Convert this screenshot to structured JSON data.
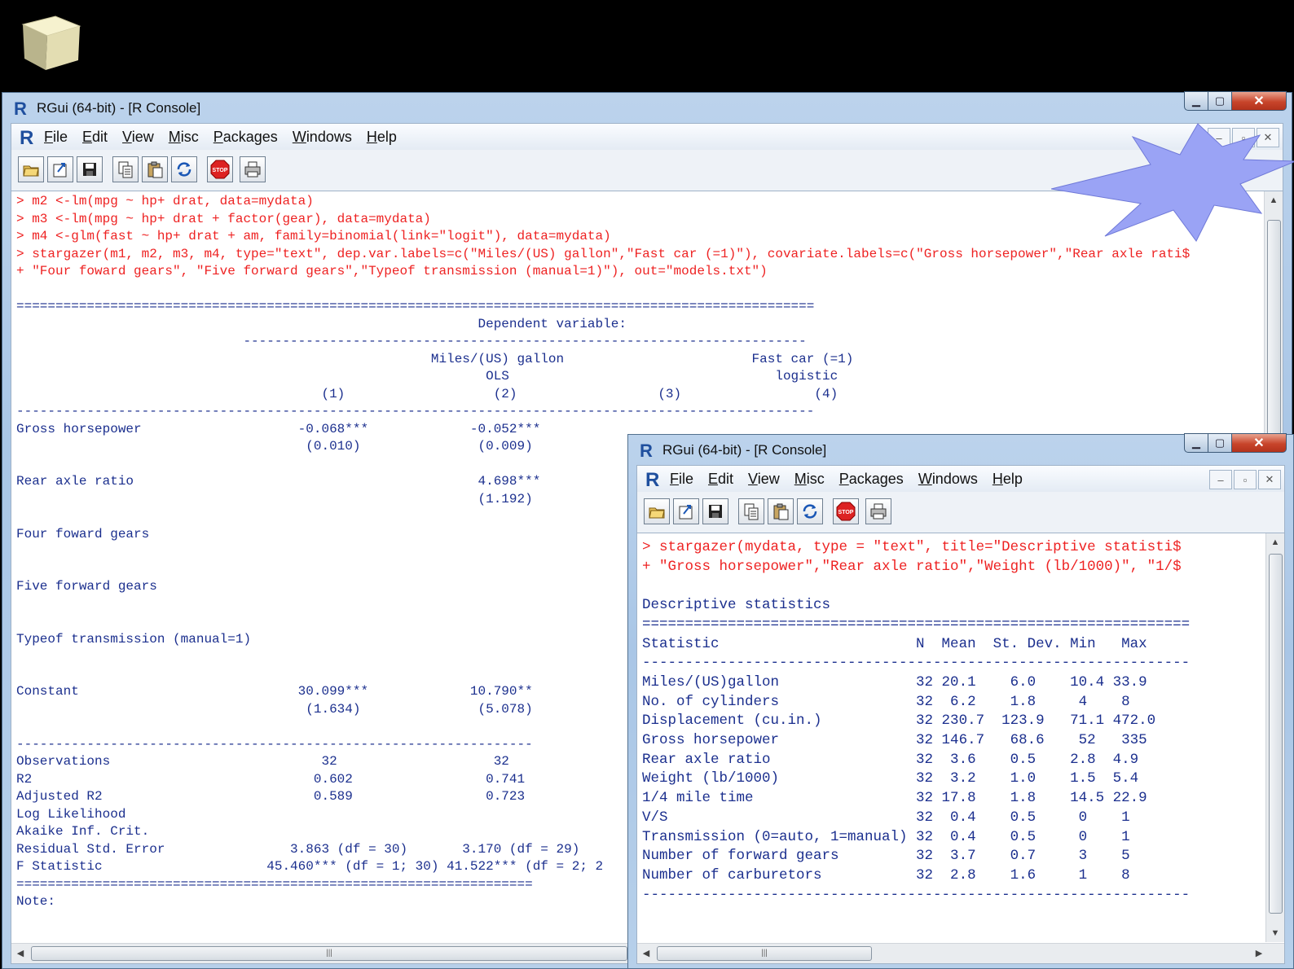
{
  "main_window": {
    "title": "RGui (64-bit) - [R Console]",
    "menus": [
      "File",
      "Edit",
      "View",
      "Misc",
      "Packages",
      "Windows",
      "Help"
    ],
    "console_lines": [
      {
        "t": "cmd",
        "s": "> m2 <-lm(mpg ~ hp+ drat, data=mydata)"
      },
      {
        "t": "cmd",
        "s": "> m3 <-lm(mpg ~ hp+ drat + factor(gear), data=mydata)"
      },
      {
        "t": "cmd",
        "s": "> m4 <-glm(fast ~ hp+ drat + am, family=binomial(link=\"logit\"), data=mydata)"
      },
      {
        "t": "cmd",
        "s": "> stargazer(m1, m2, m3, m4, type=\"text\", dep.var.labels=c(\"Miles/(US) gallon\",\"Fast car (=1)\"), covariate.labels=c(\"Gross horsepower\",\"Rear axle rati$"
      },
      {
        "t": "cmd",
        "s": "+ \"Four foward gears\", \"Five forward gears\",\"Typeof transmission (manual=1)\"), out=\"models.txt\")"
      },
      {
        "t": "out",
        "s": ""
      },
      {
        "t": "out",
        "s": "======================================================================================================"
      },
      {
        "t": "out",
        "s": "                                                           Dependent variable:"
      },
      {
        "t": "out",
        "s": "                             ------------------------------------------------------------------------"
      },
      {
        "t": "out",
        "s": "                                                     Miles/(US) gallon                        Fast car (=1)"
      },
      {
        "t": "out",
        "s": "                                                            OLS                                  logistic"
      },
      {
        "t": "out",
        "s": "                                       (1)                   (2)                  (3)                 (4)"
      },
      {
        "t": "out",
        "s": "------------------------------------------------------------------------------------------------------"
      },
      {
        "t": "out",
        "s": "Gross horsepower                    -0.068***             -0.052***"
      },
      {
        "t": "out",
        "s": "                                     (0.010)               (0.009)"
      },
      {
        "t": "out",
        "s": ""
      },
      {
        "t": "out",
        "s": "Rear axle ratio                                            4.698***"
      },
      {
        "t": "out",
        "s": "                                                           (1.192)"
      },
      {
        "t": "out",
        "s": ""
      },
      {
        "t": "out",
        "s": "Four foward gears"
      },
      {
        "t": "out",
        "s": ""
      },
      {
        "t": "out",
        "s": ""
      },
      {
        "t": "out",
        "s": "Five forward gears"
      },
      {
        "t": "out",
        "s": ""
      },
      {
        "t": "out",
        "s": ""
      },
      {
        "t": "out",
        "s": "Typeof transmission (manual=1)"
      },
      {
        "t": "out",
        "s": ""
      },
      {
        "t": "out",
        "s": ""
      },
      {
        "t": "out",
        "s": "Constant                            30.099***             10.790**"
      },
      {
        "t": "out",
        "s": "                                     (1.634)               (5.078)"
      },
      {
        "t": "out",
        "s": ""
      },
      {
        "t": "out",
        "s": "------------------------------------------------------------------"
      },
      {
        "t": "out",
        "s": "Observations                           32                    32"
      },
      {
        "t": "out",
        "s": "R2                                    0.602                 0.741"
      },
      {
        "t": "out",
        "s": "Adjusted R2                           0.589                 0.723"
      },
      {
        "t": "out",
        "s": "Log Likelihood"
      },
      {
        "t": "out",
        "s": "Akaike Inf. Crit."
      },
      {
        "t": "out",
        "s": "Residual Std. Error                3.863 (df = 30)       3.170 (df = 29)"
      },
      {
        "t": "out",
        "s": "F Statistic                     45.460*** (df = 1; 30) 41.522*** (df = 2; 2"
      },
      {
        "t": "out",
        "s": "=================================================================="
      },
      {
        "t": "out",
        "s": "Note:"
      }
    ]
  },
  "second_window": {
    "title": "RGui (64-bit) - [R Console]",
    "menus": [
      "File",
      "Edit",
      "View",
      "Misc",
      "Packages",
      "Windows",
      "Help"
    ],
    "console_lines": [
      {
        "t": "cmd",
        "s": "> stargazer(mydata, type = \"text\", title=\"Descriptive statisti$"
      },
      {
        "t": "cmd",
        "s": "+ \"Gross horsepower\",\"Rear axle ratio\",\"Weight (lb/1000)\", \"1/$"
      },
      {
        "t": "out",
        "s": ""
      },
      {
        "t": "out",
        "s": "Descriptive statistics"
      },
      {
        "t": "out",
        "s": "================================================================"
      },
      {
        "t": "out",
        "s": "Statistic                       N  Mean  St. Dev. Min   Max"
      },
      {
        "t": "out",
        "s": "----------------------------------------------------------------"
      },
      {
        "t": "out",
        "s": "Miles/(US)gallon                32 20.1    6.0    10.4 33.9"
      },
      {
        "t": "out",
        "s": "No. of cylinders                32  6.2    1.8     4    8"
      },
      {
        "t": "out",
        "s": "Displacement (cu.in.)           32 230.7  123.9   71.1 472.0"
      },
      {
        "t": "out",
        "s": "Gross horsepower                32 146.7   68.6    52   335"
      },
      {
        "t": "out",
        "s": "Rear axle ratio                 32  3.6    0.5    2.8  4.9"
      },
      {
        "t": "out",
        "s": "Weight (lb/1000)                32  3.2    1.0    1.5  5.4"
      },
      {
        "t": "out",
        "s": "1/4 mile time                   32 17.8    1.8    14.5 22.9"
      },
      {
        "t": "out",
        "s": "V/S                             32  0.4    0.5     0    1"
      },
      {
        "t": "out",
        "s": "Transmission (0=auto, 1=manual) 32  0.4    0.5     0    1"
      },
      {
        "t": "out",
        "s": "Number of forward gears         32  3.7    0.7     3    5"
      },
      {
        "t": "out",
        "s": "Number of carburetors           32  2.8    1.6     1    8"
      },
      {
        "t": "out",
        "s": "----------------------------------------------------------------"
      }
    ]
  },
  "toolbar_icons": [
    "open-script-icon",
    "load-workspace-icon",
    "save-icon",
    "copy-icon",
    "paste-icon",
    "refresh-icon",
    "stop-icon",
    "print-icon"
  ],
  "colors": {
    "command": "#e22222",
    "output": "#1b2f8e",
    "starburst": "#9aa3f5",
    "console_bg": "#ffffff"
  }
}
